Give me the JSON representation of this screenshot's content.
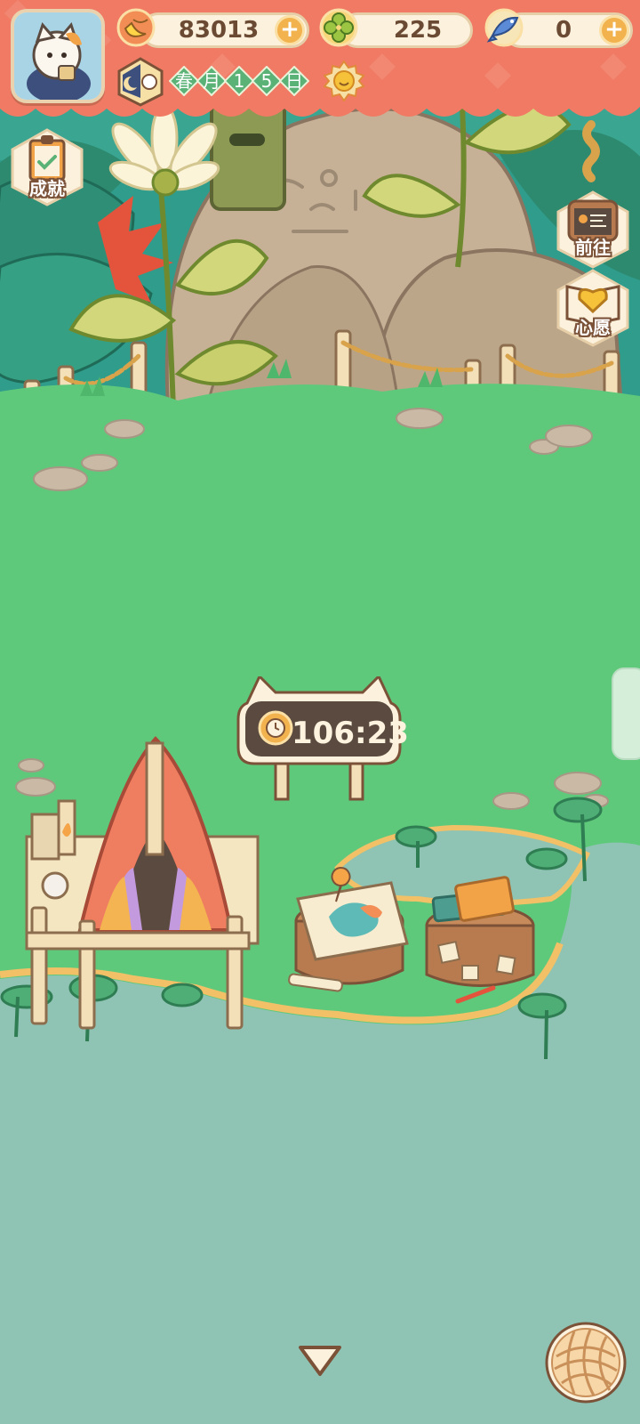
{
  "hud": {
    "bananas": "83013",
    "clovers": "225",
    "fish": "0",
    "plus_symbol": "+",
    "date": {
      "season": "春",
      "month_char": "月",
      "day_digit_1": "1",
      "day_digit_2": "5",
      "day_char": "日"
    }
  },
  "side_buttons": {
    "achievements_label": "成就",
    "go_to_label": "前往",
    "wish_label": "心愿"
  },
  "timer": {
    "value": "106:23"
  },
  "icons": {
    "avatar": "cat-avatar-icon",
    "bananas": "banana-icon",
    "clovers": "clover-icon",
    "fish": "fish-icon",
    "weather": "sun-icon",
    "moon": "moon-clock-icon",
    "achievements": "clipboard-icon",
    "go_to": "signboard-icon",
    "wish": "heart-book-icon",
    "timer": "clock-icon",
    "expand": "chevron-down-icon",
    "yarn": "yarn-ball-icon"
  },
  "colors": {
    "banner": "#f07a64",
    "grass": "#5fc97b",
    "water": "#8fc3b4",
    "pill": "#fbf1dc",
    "accent": "#f2b24e",
    "date_green": "#5bb277"
  }
}
